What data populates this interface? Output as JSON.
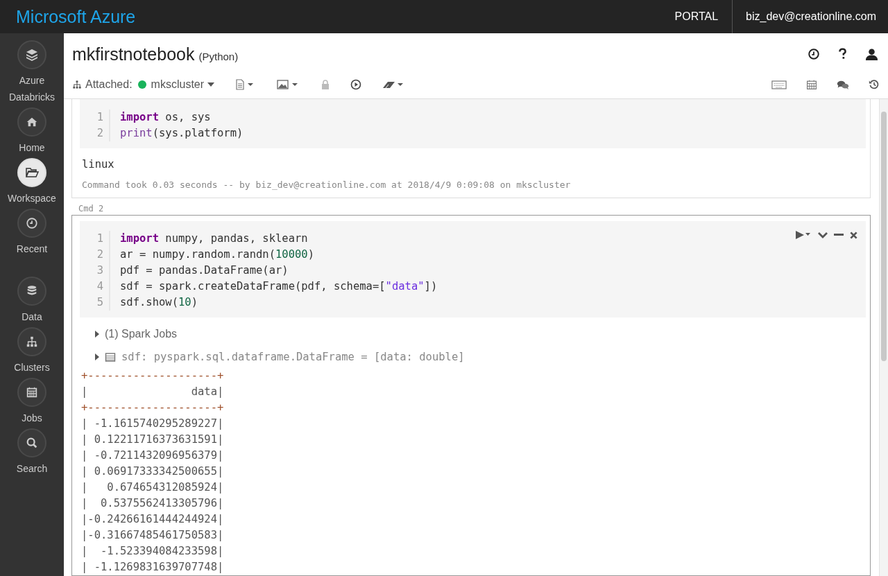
{
  "topbar": {
    "brand": "Microsoft Azure",
    "portal": "PORTAL",
    "user": "biz_dev@creationline.com"
  },
  "sidebar": {
    "items": [
      {
        "kind": "logo",
        "label": "Azure Databricks",
        "selected": false
      },
      {
        "kind": "home",
        "label": "Home",
        "selected": false
      },
      {
        "kind": "workspace",
        "label": "Workspace",
        "selected": true
      },
      {
        "kind": "recent",
        "label": "Recent",
        "selected": false
      },
      {
        "kind": "data",
        "label": "Data",
        "selected": false
      },
      {
        "kind": "clusters",
        "label": "Clusters",
        "selected": false
      },
      {
        "kind": "jobs",
        "label": "Jobs",
        "selected": false
      },
      {
        "kind": "search",
        "label": "Search",
        "selected": false
      }
    ]
  },
  "notebook": {
    "title": "mkfirstnotebook",
    "language": "(Python)",
    "attached_label": "Attached:",
    "cluster": "mkscluster"
  },
  "cells": [
    {
      "active": false,
      "code": [
        {
          "number": "1",
          "tokens": [
            {
              "text": "import",
              "kind": "keyword"
            },
            {
              "text": " os, sys",
              "kind": "plain"
            }
          ]
        },
        {
          "number": "2",
          "tokens": [
            {
              "text": "print",
              "kind": "builtin"
            },
            {
              "text": "(sys.platform)",
              "kind": "plain"
            }
          ]
        }
      ],
      "output": {
        "text": "linux",
        "footer": "Command took 0.03 seconds -- by biz_dev@creationline.com at 2018/4/9 0:09:08 on mkscluster"
      }
    },
    {
      "label": "Cmd 2",
      "active": true,
      "code": [
        {
          "number": "1",
          "tokens": [
            {
              "text": "import",
              "kind": "keyword"
            },
            {
              "text": " numpy, pandas, sklearn",
              "kind": "plain"
            }
          ]
        },
        {
          "number": "2",
          "tokens": [
            {
              "text": "ar = numpy.random.randn(",
              "kind": "plain"
            },
            {
              "text": "10000",
              "kind": "number"
            },
            {
              "text": ")",
              "kind": "plain"
            }
          ]
        },
        {
          "number": "3",
          "tokens": [
            {
              "text": "pdf = pandas.DataFrame(ar)",
              "kind": "plain"
            }
          ]
        },
        {
          "number": "4",
          "tokens": [
            {
              "text": "sdf = spark.createDataFrame(pdf, schema=[",
              "kind": "plain"
            },
            {
              "text": "\"data\"",
              "kind": "string"
            },
            {
              "text": "])",
              "kind": "plain"
            }
          ]
        },
        {
          "number": "5",
          "tokens": [
            {
              "text": "sdf.show(",
              "kind": "plain"
            },
            {
              "text": "10",
              "kind": "number"
            },
            {
              "text": ")",
              "kind": "plain"
            }
          ]
        }
      ],
      "jobs": "(1) Spark Jobs",
      "schema": "sdf: pyspark.sql.dataframe.DataFrame = [data: double]",
      "table": [
        {
          "kind": "border",
          "text": "+--------------------+"
        },
        {
          "kind": "row",
          "text": "|                data|"
        },
        {
          "kind": "border",
          "text": "+--------------------+"
        },
        {
          "kind": "row",
          "text": "| -1.1615740295289227|"
        },
        {
          "kind": "row",
          "text": "| 0.12211716373631591|"
        },
        {
          "kind": "row",
          "text": "| -0.7211432096956379|"
        },
        {
          "kind": "row",
          "text": "| 0.06917333342500655|"
        },
        {
          "kind": "row",
          "text": "|   0.674654312085924|"
        },
        {
          "kind": "row",
          "text": "|  0.5375562413305796|"
        },
        {
          "kind": "row",
          "text": "|-0.24266161444244924|"
        },
        {
          "kind": "row",
          "text": "|-0.31667485461750583|"
        },
        {
          "kind": "row",
          "text": "|  -1.523394084233598|"
        },
        {
          "kind": "row",
          "text": "| -1.1269831639707748|"
        }
      ]
    }
  ]
}
